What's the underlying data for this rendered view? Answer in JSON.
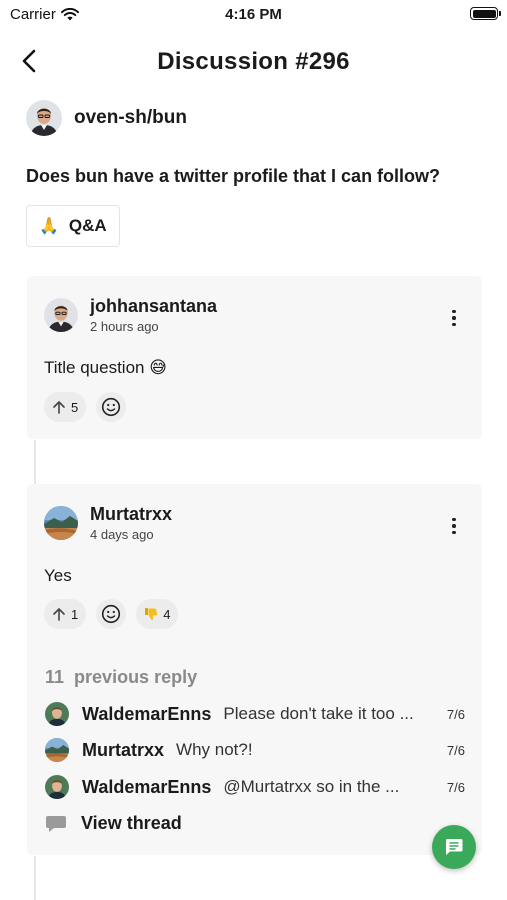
{
  "status_bar": {
    "carrier": "Carrier",
    "time": "4:16 PM"
  },
  "nav": {
    "title": "Discussion #296"
  },
  "repo": {
    "name": "oven-sh/bun"
  },
  "discussion": {
    "title": "Does bun have a twitter profile that I can follow?",
    "category": {
      "emoji": "🙏",
      "label": "Q&A"
    }
  },
  "comments": [
    {
      "user": "johhansantana",
      "time": "2 hours ago",
      "body": "Title question 😅",
      "upvotes": "5"
    },
    {
      "user": "Murtatrxx",
      "time": "4 days ago",
      "body": "Yes",
      "upvotes": "1",
      "thumbs_down": "4"
    }
  ],
  "replies": {
    "count": "11",
    "label": "previous reply",
    "items": [
      {
        "user": "WaldemarEnns",
        "text": "Please don't take it too ...",
        "date": "7/6"
      },
      {
        "user": "Murtatrxx",
        "text": "Why not?!",
        "date": "7/6"
      },
      {
        "user": "WaldemarEnns",
        "text": "@Murtatrxx so in the ...",
        "date": "7/6"
      }
    ],
    "view_thread": "View thread"
  },
  "colors": {
    "fab": "#3aa95a",
    "card": "#f7f7f7"
  },
  "icons": [
    "wifi-icon",
    "battery-icon",
    "back-chevron-icon",
    "more-vertical-icon",
    "arrow-up-icon",
    "smiley-icon",
    "thumbs-down-icon",
    "speech-bubble-icon",
    "comment-icon"
  ]
}
